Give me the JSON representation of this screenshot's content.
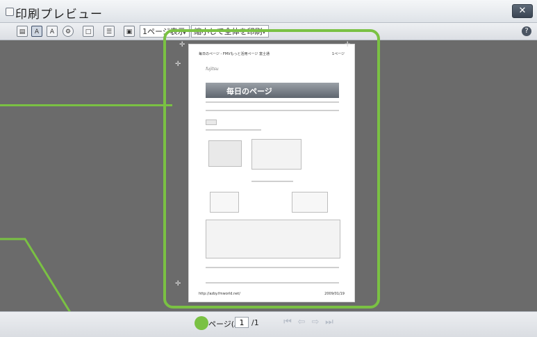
{
  "window": {
    "title": "印刷プレビュー",
    "close_label": "✕"
  },
  "toolbar": {
    "page_view_select": "1ページ表示",
    "fit_select": "縮小して全体を印刷する",
    "help_label": "?"
  },
  "page_preview": {
    "header_left": "毎日のページ - FMVもっと活用ページ 富士通",
    "header_right": "1ページ",
    "logo_text": "fujitsu",
    "banner_title": "毎日のページ",
    "footer_left": "http://azby.fmworld.net/",
    "footer_right": "2009/01/19"
  },
  "statusbar": {
    "page_label": "ページ(A)",
    "current_page": "1",
    "total_pages": "/1"
  }
}
